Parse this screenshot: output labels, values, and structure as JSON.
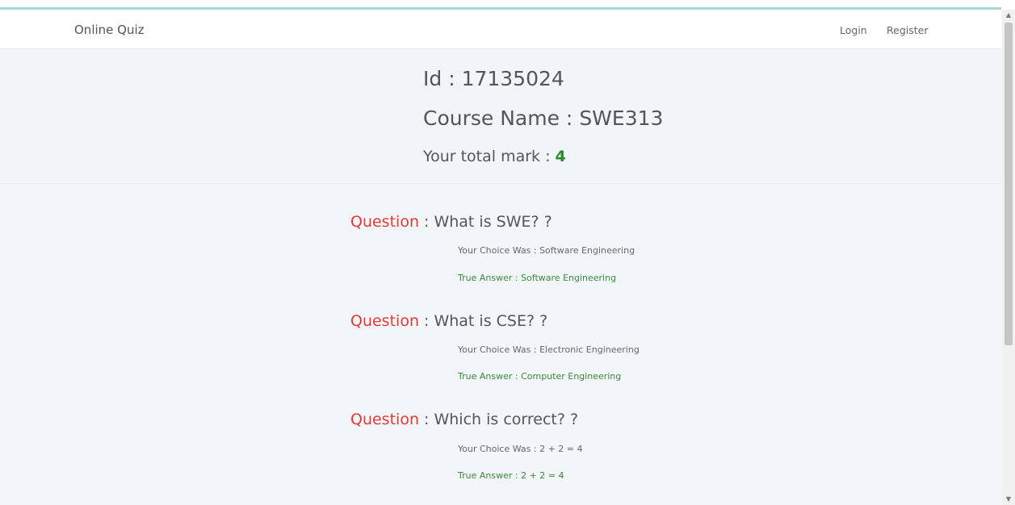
{
  "navbar": {
    "brand": "Online Quiz",
    "links": [
      "Login",
      "Register"
    ]
  },
  "header": {
    "id_label": "Id : ",
    "id_value": "17135024",
    "course_label": "Course Name : ",
    "course_value": "SWE313",
    "mark_label": "Your total mark : ",
    "mark_value": "4"
  },
  "labels": {
    "question": "Question",
    "choice_prefix": "Your Choice Was : ",
    "answer_prefix": "True Answer : "
  },
  "questions": [
    {
      "text": " : What is SWE? ?",
      "choice": "Software Engineering",
      "answer": "Software Engineering"
    },
    {
      "text": " : What is CSE? ?",
      "choice": "Electronic Engineering",
      "answer": "Computer Engineering"
    },
    {
      "text": " : Which is correct? ?",
      "choice": "2 + 2 = 4",
      "answer": "2 + 2 = 4"
    }
  ],
  "colors": {
    "question_key": "#e53935",
    "true_answer": "#3b8a3b",
    "score": "#2b8a2b"
  },
  "icons": {
    "scroll_up": "scroll-up-arrow-icon",
    "scroll_down": "scroll-down-arrow-icon"
  }
}
